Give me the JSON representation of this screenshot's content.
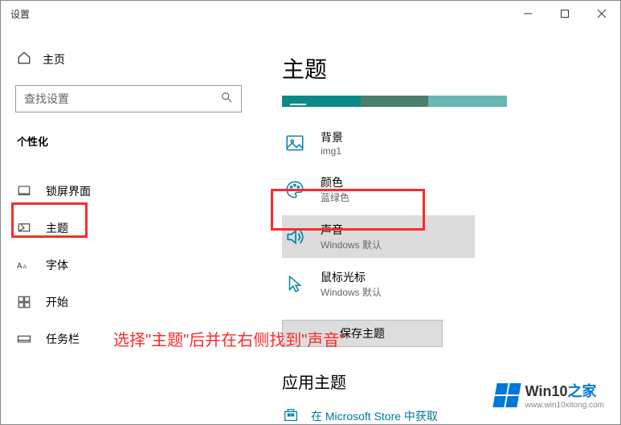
{
  "window": {
    "title": "设置"
  },
  "sidebar": {
    "home": "主页",
    "search_placeholder": "查找设置",
    "category": "个性化",
    "items": [
      {
        "label": "锁屏界面"
      },
      {
        "label": "主题"
      },
      {
        "label": "字体"
      },
      {
        "label": "开始"
      },
      {
        "label": "任务栏"
      }
    ]
  },
  "main": {
    "title": "主题",
    "settings": [
      {
        "label": "背景",
        "value": "img1"
      },
      {
        "label": "颜色",
        "value": "蓝绿色"
      },
      {
        "label": "声音",
        "value": "Windows 默认"
      },
      {
        "label": "鼠标光标",
        "value": "Windows 默认"
      }
    ],
    "save_button": "保存主题",
    "apply_header": "应用主题",
    "store_link": "在 Microsoft Store 中获取"
  },
  "annotation": "选择\"主题\"后并在右侧找到\"声音\"",
  "watermark": {
    "brand_a": "Win10",
    "brand_b": "之家",
    "url": "www.win10xitong.com"
  }
}
